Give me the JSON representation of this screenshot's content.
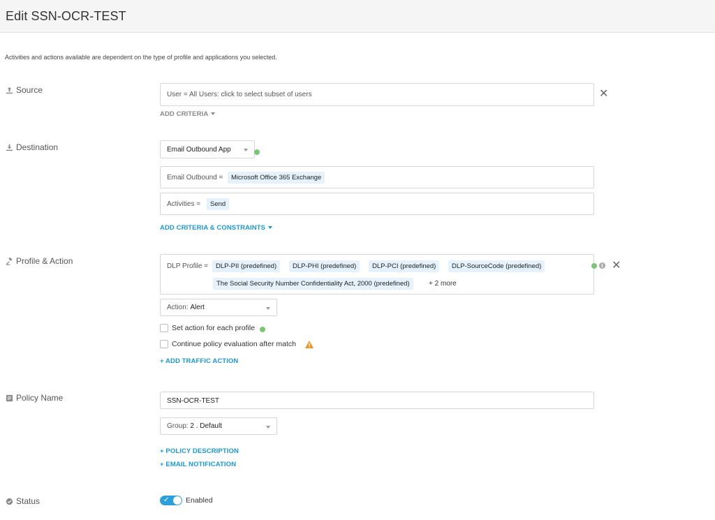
{
  "header": {
    "title": "Edit SSN-OCR-TEST"
  },
  "description": "Activities and actions available are dependent on the type of profile and applications you selected.",
  "source": {
    "label": "Source",
    "user_field": "User = All Users: click to select subset of users",
    "add_criteria": "ADD CRITERIA"
  },
  "destination": {
    "label": "Destination",
    "app_select": "Email Outbound App",
    "email_outbound_key": "Email Outbound =",
    "email_outbound_value": "Microsoft Office 365 Exchange",
    "activities_key": "Activities =",
    "activities_value": "Send",
    "add_criteria": "ADD CRITERIA & CONSTRAINTS"
  },
  "profile_action": {
    "label": "Profile & Action",
    "dlp_key": "DLP Profile =",
    "dlp_profiles": [
      "DLP-PII (predefined)",
      "DLP-PHI (predefined)",
      "DLP-PCI (predefined)",
      "DLP-SourceCode (predefined)",
      "The Social Security Number Confidentiality Act, 2000 (predefined)"
    ],
    "more": "+ 2 more",
    "action_key": "Action:",
    "action_value": "Alert",
    "set_action_label": "Set action for each profile",
    "continue_label": "Continue policy evaluation after match",
    "add_traffic": "+ ADD TRAFFIC ACTION"
  },
  "policy": {
    "label": "Policy Name",
    "name_value": "SSN-OCR-TEST",
    "group_key": "Group:",
    "group_value": "2 . Default",
    "add_description": "+ POLICY DESCRIPTION",
    "add_email": "+ EMAIL NOTIFICATION"
  },
  "status": {
    "label": "Status",
    "toggle_label": "Enabled"
  },
  "colors": {
    "accent": "#1a97d6",
    "chip_bg": "#e6f2fb",
    "green_dot": "#7cc576",
    "warning": "#f0931e"
  }
}
